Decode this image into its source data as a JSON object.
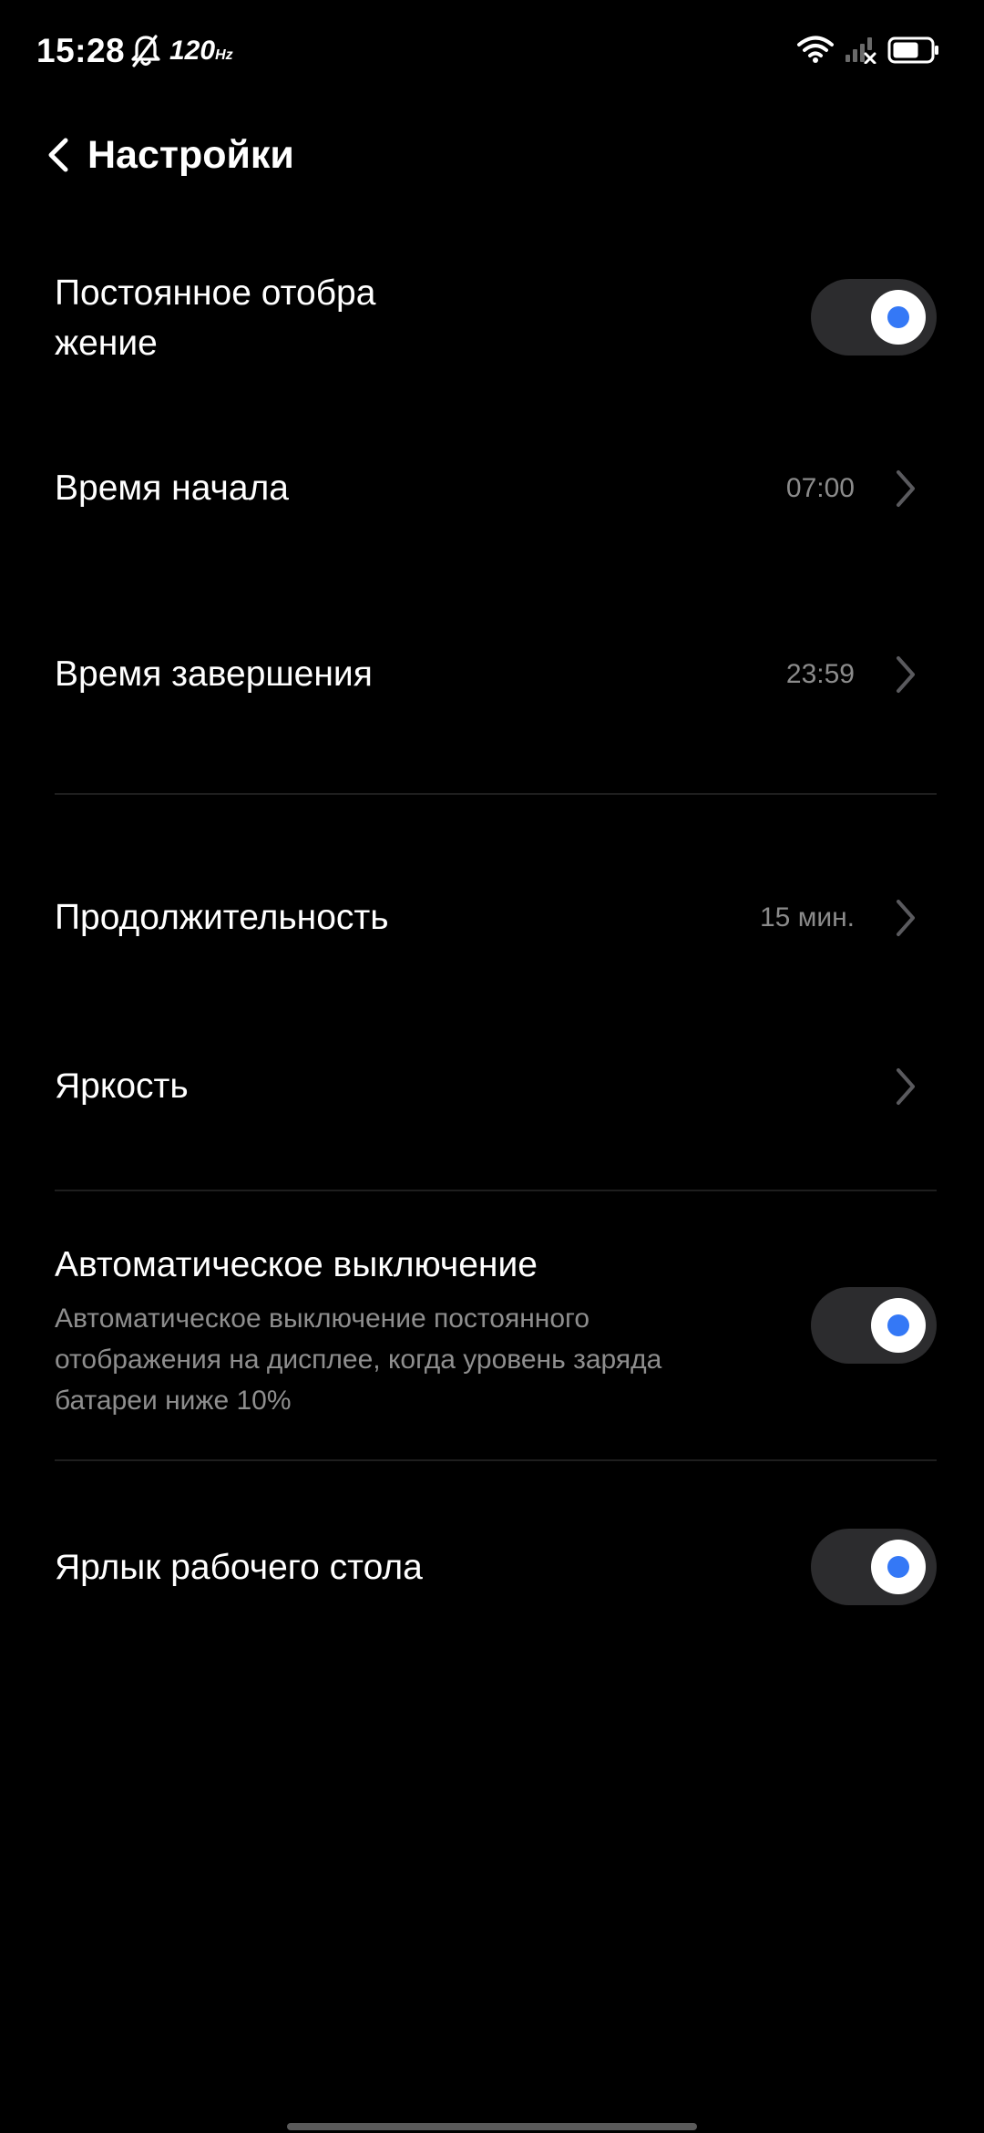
{
  "status_bar": {
    "time": "15:28",
    "refresh_rate": "120",
    "refresh_unit": "Hz",
    "icons": [
      "bell-off-icon",
      "wifi-icon",
      "signal-off-icon",
      "battery-icon"
    ],
    "battery_level": 0.7
  },
  "header": {
    "back_icon": "chevron-left-icon",
    "title": "Настройки"
  },
  "settings": {
    "always_on": {
      "title": "Постоянное отобра жение",
      "enabled": true
    },
    "start_time": {
      "title": "Время начала",
      "value": "07:00"
    },
    "end_time": {
      "title": "Время завершения",
      "value": "23:59"
    },
    "duration": {
      "title": "Продолжительность",
      "value": "15 мин."
    },
    "brightness": {
      "title": "Яркость"
    },
    "auto_off": {
      "title": "Автоматическое выключение",
      "description": "Автоматическое выключение постоянного отображения на дисплее, когда уровень заряда батареи ниже 10%",
      "enabled": true
    },
    "desktop_shortcut": {
      "title": "Ярлык рабочего стола",
      "enabled": true
    }
  },
  "colors": {
    "background": "#000000",
    "accent": "#3478f6",
    "toggle_track": "#2c2c2e",
    "secondary_text": "#8b8b8b"
  }
}
